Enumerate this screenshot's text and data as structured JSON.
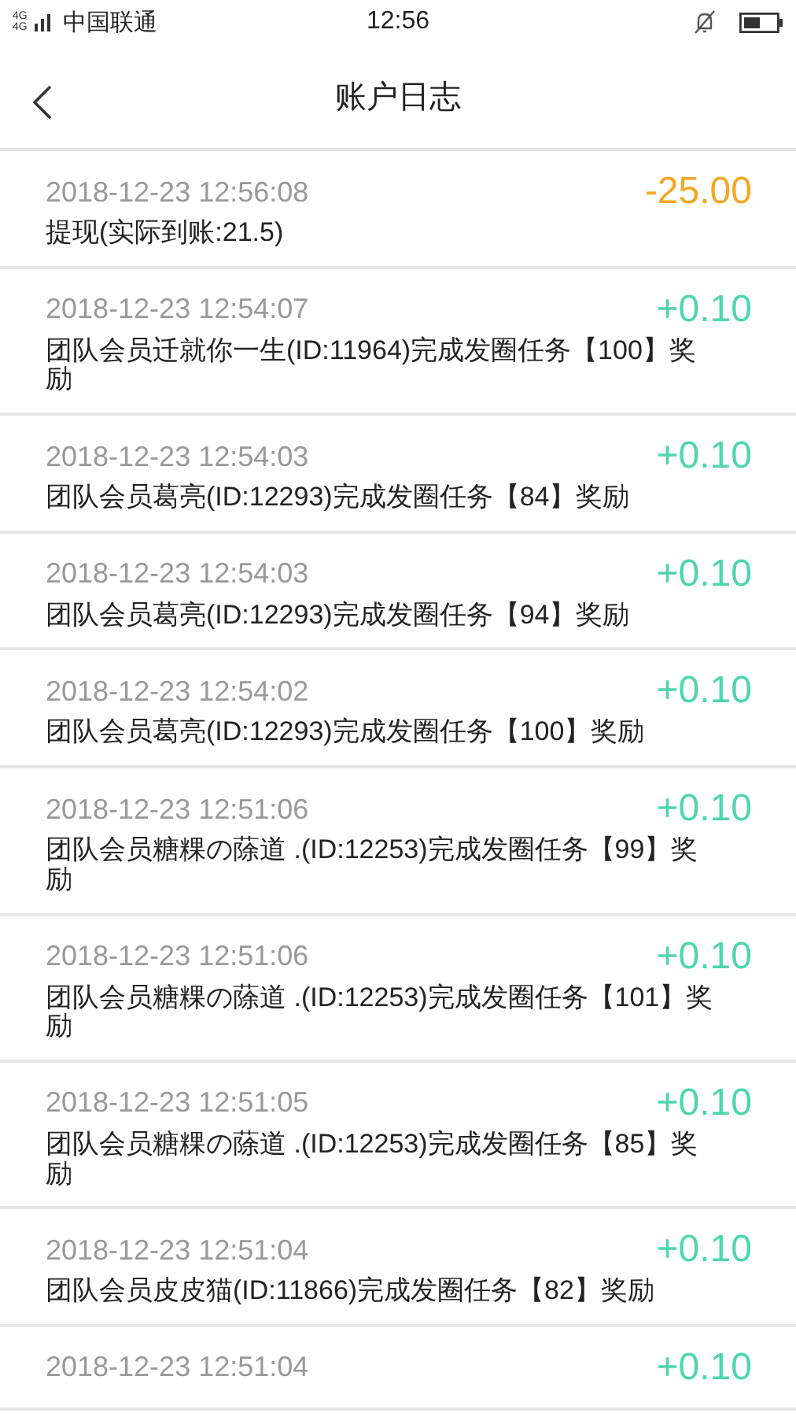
{
  "status_bar": {
    "network": "4G4G",
    "carrier": "中国联通",
    "time": "12:56"
  },
  "header": {
    "title": "账户日志"
  },
  "entries": [
    {
      "time": "2018-12-23 12:56:08",
      "amount": "-25.00",
      "kind": "debit",
      "description": "提现(实际到账:21.5)"
    },
    {
      "time": "2018-12-23 12:54:07",
      "amount": "+0.10",
      "kind": "credit",
      "description": "团队会员迁就你一生(ID:11964)完成发圈任务【100】奖励"
    },
    {
      "time": "2018-12-23 12:54:03",
      "amount": "+0.10",
      "kind": "credit",
      "description": "团队会员葛亮(ID:12293)完成发圈任务【84】奖励"
    },
    {
      "time": "2018-12-23 12:54:03",
      "amount": "+0.10",
      "kind": "credit",
      "description": "团队会员葛亮(ID:12293)完成发圈任务【94】奖励"
    },
    {
      "time": "2018-12-23 12:54:02",
      "amount": "+0.10",
      "kind": "credit",
      "description": "团队会员葛亮(ID:12293)完成发圈任务【100】奖励"
    },
    {
      "time": "2018-12-23 12:51:06",
      "amount": "+0.10",
      "kind": "credit",
      "description": "团队会员糖粿の蒢道 .(ID:12253)完成发圈任务【99】奖励"
    },
    {
      "time": "2018-12-23 12:51:06",
      "amount": "+0.10",
      "kind": "credit",
      "description": "团队会员糖粿の蒢道 .(ID:12253)完成发圈任务【101】奖励"
    },
    {
      "time": "2018-12-23 12:51:05",
      "amount": "+0.10",
      "kind": "credit",
      "description": "团队会员糖粿の蒢道 .(ID:12253)完成发圈任务【85】奖励"
    },
    {
      "time": "2018-12-23 12:51:04",
      "amount": "+0.10",
      "kind": "credit",
      "description": "团队会员皮皮猫(ID:11866)完成发圈任务【82】奖励"
    },
    {
      "time": "2018-12-23 12:51:04",
      "amount": "+0.10",
      "kind": "credit"
    }
  ]
}
